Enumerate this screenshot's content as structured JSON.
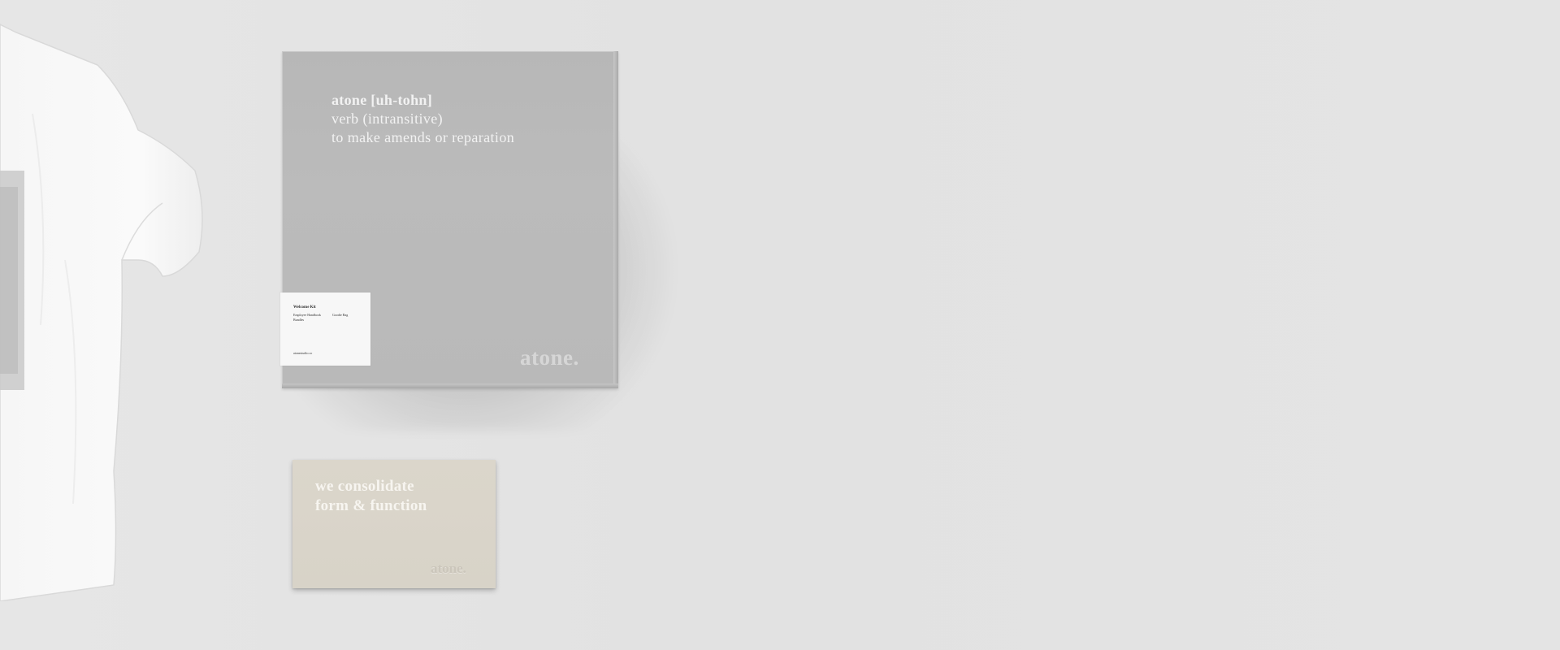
{
  "box": {
    "line1": "atone [uh-tohn]",
    "line2": "verb (intransitive)",
    "line3": "to make amends or reparation",
    "logo": "atone."
  },
  "label": {
    "title": "Welcome Kit",
    "item1": "Employee Handbook",
    "item2": "Bundles",
    "item3": "Goodie Bag",
    "url": "atonestudio.co"
  },
  "card": {
    "line1": "we consolidate",
    "line2": "form & function",
    "logo": "atone."
  }
}
